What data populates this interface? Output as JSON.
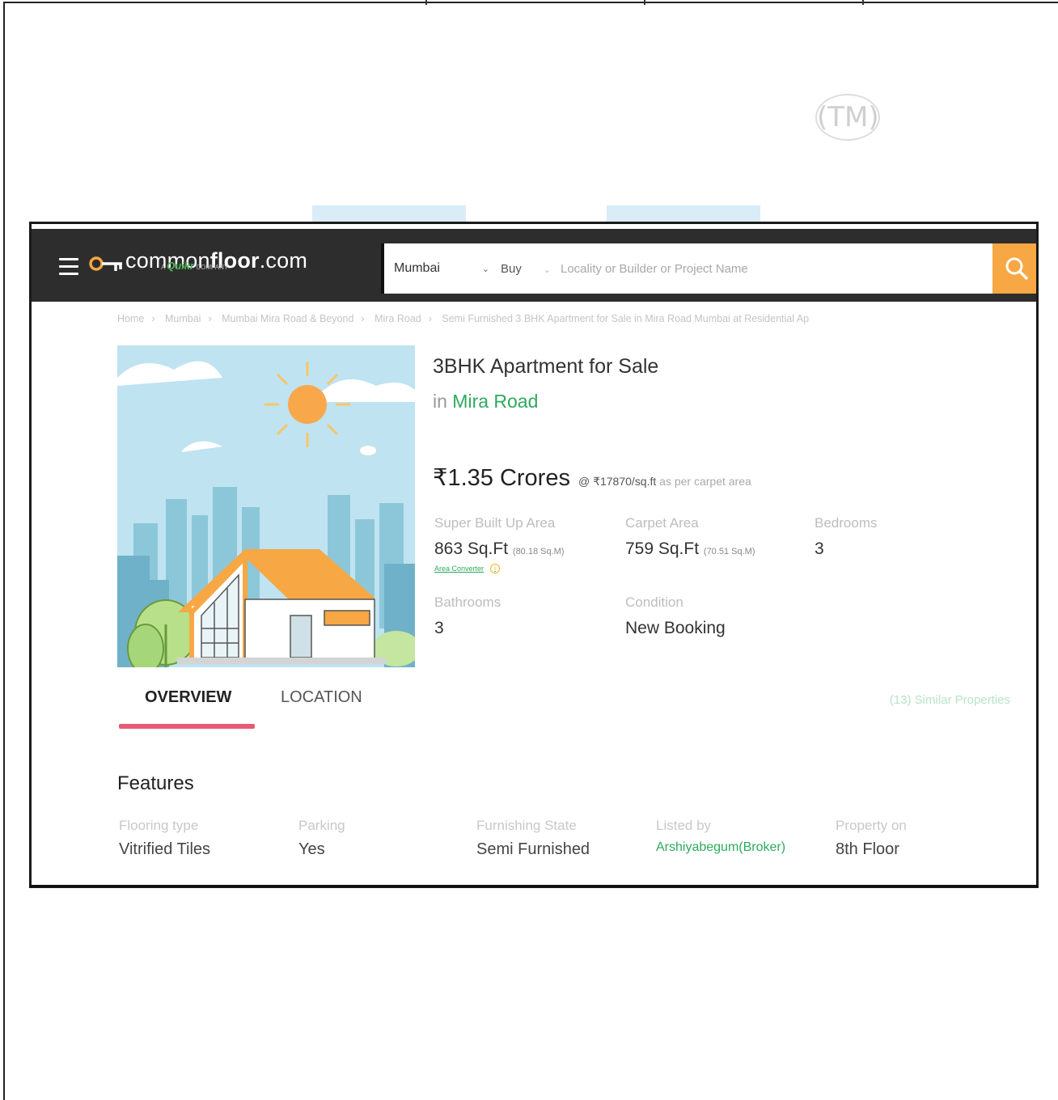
{
  "watermark": {
    "tm": "(TM)"
  },
  "header": {
    "logo_text_light": "common",
    "logo_text_bold": "floor",
    "logo_text_domain": ".com",
    "logo_sub_prefix": "A",
    "logo_sub_brand": "Quikr",
    "logo_sub_suffix": "COMPANY",
    "city": "Mumbai",
    "transaction": "Buy",
    "search_placeholder": "Locality or Builder or Project Name"
  },
  "breadcrumb": {
    "items": [
      "Home",
      "Mumbai",
      "Mumbai Mira Road & Beyond",
      "Mira Road",
      "Semi Furnished 3 BHK Apartment for Sale in Mira Road Mumbai at Residential Ap"
    ]
  },
  "listing": {
    "title": "3BHK Apartment for Sale",
    "in_word": "in",
    "locality": "Mira Road",
    "price": "₹1.35 Crores",
    "price_rate": "@ ₹17870/sq.ft",
    "price_rate_note": "as per carpet area"
  },
  "facts": {
    "super_built_up": {
      "label": "Super Built Up Area",
      "value": "863 Sq.Ft",
      "alt": "(80.18 Sq.M)",
      "link": "Area Converter"
    },
    "carpet": {
      "label": "Carpet Area",
      "value": "759 Sq.Ft",
      "alt": "(70.51 Sq.M)"
    },
    "bedrooms": {
      "label": "Bedrooms",
      "value": "3"
    },
    "bathrooms": {
      "label": "Bathrooms",
      "value": "3"
    },
    "condition": {
      "label": "Condition",
      "value": "New Booking"
    }
  },
  "tabs": {
    "overview": "OVERVIEW",
    "location": "LOCATION",
    "similar": "(13) Similar Properties"
  },
  "features": {
    "title": "Features",
    "items": [
      {
        "label": "Flooring type",
        "value": "Vitrified Tiles"
      },
      {
        "label": "Parking",
        "value": "Yes"
      },
      {
        "label": "Furnishing State",
        "value": "Semi Furnished"
      },
      {
        "label": "Listed by",
        "value": "Arshiyabegum(Broker)"
      },
      {
        "label": "Property on",
        "value": "8th Floor"
      }
    ]
  },
  "colors": {
    "header_bg": "#2d2d2d",
    "search_button": "#f7a743",
    "accent_green": "#2eaa5c",
    "tab_underline": "#e85a75"
  },
  "icons": {
    "menu": "hamburger-menu-icon",
    "logo": "key-logo-icon",
    "search": "search-icon",
    "dropdown": "chevron-down-icon",
    "info": "info-icon"
  }
}
